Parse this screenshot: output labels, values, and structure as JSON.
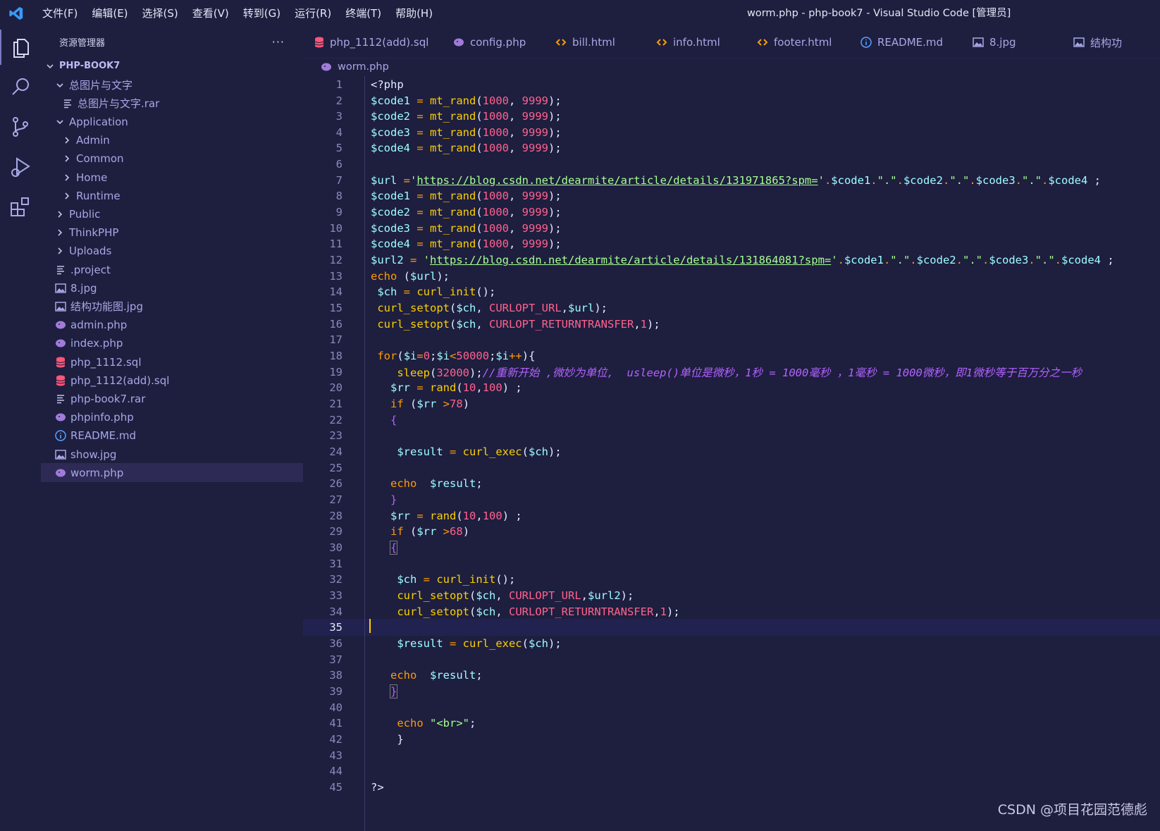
{
  "titlebar": {
    "menus": [
      "文件(F)",
      "编辑(E)",
      "选择(S)",
      "查看(V)",
      "转到(G)",
      "运行(R)",
      "终端(T)",
      "帮助(H)"
    ],
    "window_title": "worm.php - php-book7 - Visual Studio Code [管理员]"
  },
  "activity": [
    "explorer-icon",
    "search-icon",
    "source-control-icon",
    "run-debug-icon",
    "extensions-icon"
  ],
  "sidebar": {
    "title": "资源管理器",
    "more": "···",
    "root": "PHP-BOOK7",
    "items": [
      {
        "label": "总图片与文字",
        "kind": "folder-open",
        "depth": 1
      },
      {
        "label": "总图片与文字.rar",
        "kind": "file",
        "depth": 2
      },
      {
        "label": "Application",
        "kind": "folder-open",
        "depth": 1
      },
      {
        "label": "Admin",
        "kind": "folder",
        "depth": 2
      },
      {
        "label": "Common",
        "kind": "folder",
        "depth": 2
      },
      {
        "label": "Home",
        "kind": "folder",
        "depth": 2
      },
      {
        "label": "Runtime",
        "kind": "folder",
        "depth": 2
      },
      {
        "label": "Public",
        "kind": "folder",
        "depth": 1
      },
      {
        "label": "ThinkPHP",
        "kind": "folder",
        "depth": 1
      },
      {
        "label": "Uploads",
        "kind": "folder",
        "depth": 1
      },
      {
        "label": ".project",
        "kind": "file",
        "depth": 1
      },
      {
        "label": "8.jpg",
        "kind": "image",
        "depth": 1
      },
      {
        "label": "结构功能图.jpg",
        "kind": "image",
        "depth": 1
      },
      {
        "label": "admin.php",
        "kind": "php",
        "depth": 1
      },
      {
        "label": "index.php",
        "kind": "php",
        "depth": 1
      },
      {
        "label": "php_1112.sql",
        "kind": "sql",
        "depth": 1
      },
      {
        "label": "php_1112(add).sql",
        "kind": "sql",
        "depth": 1
      },
      {
        "label": "php-book7.rar",
        "kind": "file",
        "depth": 1
      },
      {
        "label": "phpinfo.php",
        "kind": "php",
        "depth": 1
      },
      {
        "label": "README.md",
        "kind": "info",
        "depth": 1
      },
      {
        "label": "show.jpg",
        "kind": "image",
        "depth": 1
      },
      {
        "label": "worm.php",
        "kind": "php",
        "depth": 1,
        "selected": true
      }
    ]
  },
  "tabs": [
    {
      "label": "php_1112(add).sql",
      "kind": "sql"
    },
    {
      "label": "config.php",
      "kind": "php"
    },
    {
      "label": "bill.html",
      "kind": "html"
    },
    {
      "label": "info.html",
      "kind": "html"
    },
    {
      "label": "footer.html",
      "kind": "html"
    },
    {
      "label": "README.md",
      "kind": "info"
    },
    {
      "label": "8.jpg",
      "kind": "image"
    },
    {
      "label": "结构功",
      "kind": "image"
    }
  ],
  "breadcrumb": "worm.php",
  "editor": {
    "current_line": 35,
    "lines": [
      [
        [
          "pl",
          "<?php"
        ]
      ],
      [
        [
          "var",
          "$code1"
        ],
        [
          "op",
          " = "
        ],
        [
          "fn",
          "mt_rand"
        ],
        [
          "pl",
          "("
        ],
        [
          "num",
          "1000"
        ],
        [
          "pl",
          ", "
        ],
        [
          "num",
          "9999"
        ],
        [
          "pl",
          ");"
        ]
      ],
      [
        [
          "var",
          "$code2"
        ],
        [
          "op",
          " = "
        ],
        [
          "fn",
          "mt_rand"
        ],
        [
          "pl",
          "("
        ],
        [
          "num",
          "1000"
        ],
        [
          "pl",
          ", "
        ],
        [
          "num",
          "9999"
        ],
        [
          "pl",
          ");"
        ]
      ],
      [
        [
          "var",
          "$code3"
        ],
        [
          "op",
          " = "
        ],
        [
          "fn",
          "mt_rand"
        ],
        [
          "pl",
          "("
        ],
        [
          "num",
          "1000"
        ],
        [
          "pl",
          ", "
        ],
        [
          "num",
          "9999"
        ],
        [
          "pl",
          ");"
        ]
      ],
      [
        [
          "var",
          "$code4"
        ],
        [
          "op",
          " = "
        ],
        [
          "fn",
          "mt_rand"
        ],
        [
          "pl",
          "("
        ],
        [
          "num",
          "1000"
        ],
        [
          "pl",
          ", "
        ],
        [
          "num",
          "9999"
        ],
        [
          "pl",
          ");"
        ]
      ],
      [],
      [
        [
          "var",
          "$url"
        ],
        [
          "op",
          " ="
        ],
        [
          "str",
          "'"
        ],
        [
          "url",
          "https://blog.csdn.net/dearmite/article/details/131971865?spm="
        ],
        [
          "str",
          "'"
        ],
        [
          "op",
          "."
        ],
        [
          "var",
          "$code1"
        ],
        [
          "op",
          "."
        ],
        [
          "str",
          "\".\""
        ],
        [
          "op",
          "."
        ],
        [
          "var",
          "$code2"
        ],
        [
          "op",
          "."
        ],
        [
          "str",
          "\".\""
        ],
        [
          "op",
          "."
        ],
        [
          "var",
          "$code3"
        ],
        [
          "op",
          "."
        ],
        [
          "str",
          "\".\""
        ],
        [
          "op",
          "."
        ],
        [
          "var",
          "$code4"
        ],
        [
          "pl",
          " ;"
        ]
      ],
      [
        [
          "var",
          "$code1"
        ],
        [
          "op",
          " = "
        ],
        [
          "fn",
          "mt_rand"
        ],
        [
          "pl",
          "("
        ],
        [
          "num",
          "1000"
        ],
        [
          "pl",
          ", "
        ],
        [
          "num",
          "9999"
        ],
        [
          "pl",
          ");"
        ]
      ],
      [
        [
          "var",
          "$code2"
        ],
        [
          "op",
          " = "
        ],
        [
          "fn",
          "mt_rand"
        ],
        [
          "pl",
          "("
        ],
        [
          "num",
          "1000"
        ],
        [
          "pl",
          ", "
        ],
        [
          "num",
          "9999"
        ],
        [
          "pl",
          ");"
        ]
      ],
      [
        [
          "var",
          "$code3"
        ],
        [
          "op",
          " = "
        ],
        [
          "fn",
          "mt_rand"
        ],
        [
          "pl",
          "("
        ],
        [
          "num",
          "1000"
        ],
        [
          "pl",
          ", "
        ],
        [
          "num",
          "9999"
        ],
        [
          "pl",
          ");"
        ]
      ],
      [
        [
          "var",
          "$code4"
        ],
        [
          "op",
          " = "
        ],
        [
          "fn",
          "mt_rand"
        ],
        [
          "pl",
          "("
        ],
        [
          "num",
          "1000"
        ],
        [
          "pl",
          ", "
        ],
        [
          "num",
          "9999"
        ],
        [
          "pl",
          ");"
        ]
      ],
      [
        [
          "var",
          "$url2"
        ],
        [
          "op",
          " = "
        ],
        [
          "str",
          "'"
        ],
        [
          "url",
          "https://blog.csdn.net/dearmite/article/details/131864081?spm="
        ],
        [
          "str",
          "'"
        ],
        [
          "op",
          "."
        ],
        [
          "var",
          "$code1"
        ],
        [
          "op",
          "."
        ],
        [
          "str",
          "\".\""
        ],
        [
          "op",
          "."
        ],
        [
          "var",
          "$code2"
        ],
        [
          "op",
          "."
        ],
        [
          "str",
          "\".\""
        ],
        [
          "op",
          "."
        ],
        [
          "var",
          "$code3"
        ],
        [
          "op",
          "."
        ],
        [
          "str",
          "\".\""
        ],
        [
          "op",
          "."
        ],
        [
          "var",
          "$code4"
        ],
        [
          "pl",
          " ;"
        ]
      ],
      [
        [
          "kw",
          "echo"
        ],
        [
          "pl",
          " ("
        ],
        [
          "var",
          "$url"
        ],
        [
          "pl",
          ");"
        ]
      ],
      [
        [
          "pl",
          " "
        ],
        [
          "var",
          "$ch"
        ],
        [
          "op",
          " = "
        ],
        [
          "fn",
          "curl_init"
        ],
        [
          "pl",
          "();"
        ]
      ],
      [
        [
          "pl",
          " "
        ],
        [
          "fn",
          "curl_setopt"
        ],
        [
          "pl",
          "("
        ],
        [
          "var",
          "$ch"
        ],
        [
          "pl",
          ", "
        ],
        [
          "const",
          "CURLOPT_URL"
        ],
        [
          "pl",
          ","
        ],
        [
          "var",
          "$url"
        ],
        [
          "pl",
          ");"
        ]
      ],
      [
        [
          "pl",
          " "
        ],
        [
          "fn",
          "curl_setopt"
        ],
        [
          "pl",
          "("
        ],
        [
          "var",
          "$ch"
        ],
        [
          "pl",
          ", "
        ],
        [
          "const",
          "CURLOPT_RETURNTRANSFER"
        ],
        [
          "pl",
          ","
        ],
        [
          "num",
          "1"
        ],
        [
          "pl",
          ");"
        ]
      ],
      [],
      [
        [
          "pl",
          " "
        ],
        [
          "kw",
          "for"
        ],
        [
          "pl",
          "("
        ],
        [
          "var",
          "$i"
        ],
        [
          "op",
          "="
        ],
        [
          "num",
          "0"
        ],
        [
          "pl",
          ";"
        ],
        [
          "var",
          "$i"
        ],
        [
          "op",
          "<"
        ],
        [
          "num",
          "50000"
        ],
        [
          "pl",
          ";"
        ],
        [
          "var",
          "$i"
        ],
        [
          "op",
          "++"
        ],
        [
          "pl",
          "){"
        ]
      ],
      [
        [
          "pl",
          "    "
        ],
        [
          "fn",
          "sleep"
        ],
        [
          "pl",
          "("
        ],
        [
          "num",
          "32000"
        ],
        [
          "pl",
          ");"
        ],
        [
          "cmt",
          "//重新开始 ,微妙为单位,  usleep()单位是微秒，1秒 = 1000毫秒 ，1毫秒 = 1000微秒，即1微秒等于百万分之一秒"
        ]
      ],
      [
        [
          "pl",
          "   "
        ],
        [
          "var",
          "$rr"
        ],
        [
          "op",
          " = "
        ],
        [
          "fn",
          "rand"
        ],
        [
          "pl",
          "("
        ],
        [
          "num",
          "10"
        ],
        [
          "pl",
          ","
        ],
        [
          "num",
          "100"
        ],
        [
          "pl",
          ") ;"
        ]
      ],
      [
        [
          "pl",
          "   "
        ],
        [
          "kw",
          "if"
        ],
        [
          "pl",
          " ("
        ],
        [
          "var",
          "$rr"
        ],
        [
          "op",
          " >"
        ],
        [
          "num",
          "78"
        ],
        [
          "pl",
          ")"
        ]
      ],
      [
        [
          "pl",
          "   "
        ],
        [
          "br",
          "{"
        ]
      ],
      [],
      [
        [
          "pl",
          "    "
        ],
        [
          "var",
          "$result"
        ],
        [
          "op",
          " = "
        ],
        [
          "fn",
          "curl_exec"
        ],
        [
          "pl",
          "("
        ],
        [
          "var",
          "$ch"
        ],
        [
          "pl",
          ");"
        ]
      ],
      [],
      [
        [
          "pl",
          "   "
        ],
        [
          "kw",
          "echo"
        ],
        [
          "pl",
          "  "
        ],
        [
          "var",
          "$result"
        ],
        [
          "pl",
          ";"
        ]
      ],
      [
        [
          "pl",
          "   "
        ],
        [
          "br",
          "}"
        ]
      ],
      [
        [
          "pl",
          "   "
        ],
        [
          "var",
          "$rr"
        ],
        [
          "op",
          " = "
        ],
        [
          "fn",
          "rand"
        ],
        [
          "pl",
          "("
        ],
        [
          "num",
          "10"
        ],
        [
          "pl",
          ","
        ],
        [
          "num",
          "100"
        ],
        [
          "pl",
          ") ;"
        ]
      ],
      [
        [
          "pl",
          "   "
        ],
        [
          "kw",
          "if"
        ],
        [
          "pl",
          " ("
        ],
        [
          "var",
          "$rr"
        ],
        [
          "op",
          " >"
        ],
        [
          "num",
          "68"
        ],
        [
          "pl",
          ")"
        ]
      ],
      [
        [
          "pl",
          "   "
        ],
        [
          "brh",
          "{"
        ]
      ],
      [],
      [
        [
          "pl",
          "    "
        ],
        [
          "var",
          "$ch"
        ],
        [
          "op",
          " = "
        ],
        [
          "fn",
          "curl_init"
        ],
        [
          "pl",
          "();"
        ]
      ],
      [
        [
          "pl",
          "    "
        ],
        [
          "fn",
          "curl_setopt"
        ],
        [
          "pl",
          "("
        ],
        [
          "var",
          "$ch"
        ],
        [
          "pl",
          ", "
        ],
        [
          "const",
          "CURLOPT_URL"
        ],
        [
          "pl",
          ","
        ],
        [
          "var",
          "$url2"
        ],
        [
          "pl",
          ");"
        ]
      ],
      [
        [
          "pl",
          "    "
        ],
        [
          "fn",
          "curl_setopt"
        ],
        [
          "pl",
          "("
        ],
        [
          "var",
          "$ch"
        ],
        [
          "pl",
          ", "
        ],
        [
          "const",
          "CURLOPT_RETURNTRANSFER"
        ],
        [
          "pl",
          ","
        ],
        [
          "num",
          "1"
        ],
        [
          "pl",
          ");"
        ]
      ],
      [],
      [
        [
          "pl",
          "    "
        ],
        [
          "var",
          "$result"
        ],
        [
          "op",
          " = "
        ],
        [
          "fn",
          "curl_exec"
        ],
        [
          "pl",
          "("
        ],
        [
          "var",
          "$ch"
        ],
        [
          "pl",
          ");"
        ]
      ],
      [],
      [
        [
          "pl",
          "   "
        ],
        [
          "kw",
          "echo"
        ],
        [
          "pl",
          "  "
        ],
        [
          "var",
          "$result"
        ],
        [
          "pl",
          ";"
        ]
      ],
      [
        [
          "pl",
          "   "
        ],
        [
          "brh",
          "}"
        ]
      ],
      [],
      [
        [
          "pl",
          "    "
        ],
        [
          "kw",
          "echo"
        ],
        [
          "pl",
          " "
        ],
        [
          "str",
          "\"<br>\""
        ],
        [
          "pl",
          ";"
        ]
      ],
      [
        [
          "pl",
          "    "
        ],
        [
          "pl",
          "}"
        ]
      ],
      [],
      [],
      [
        [
          "pl",
          "?>"
        ]
      ]
    ]
  },
  "watermark": "CSDN @项目花园范德彪",
  "colors": {
    "background": "#1e1e3f",
    "variable": "#9effff",
    "function": "#fad000",
    "number": "#ff628c",
    "string": "#a5ff90",
    "comment": "#b362ff"
  }
}
